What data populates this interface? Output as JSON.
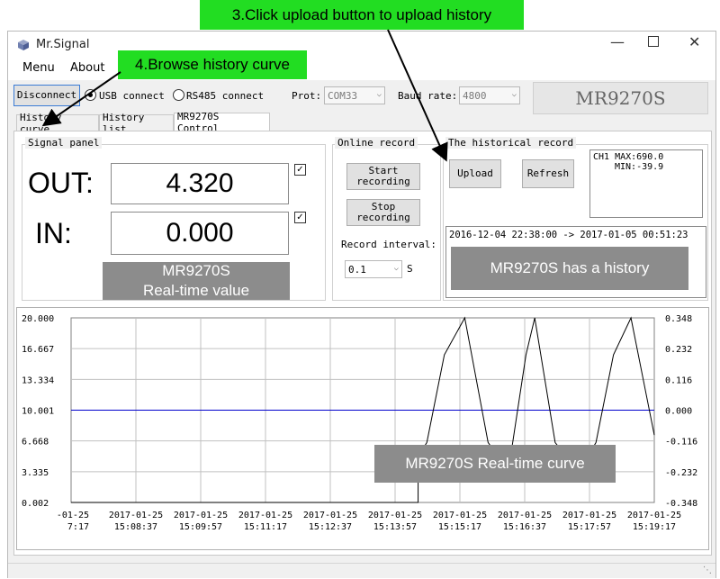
{
  "window": {
    "title": "Mr.Signal"
  },
  "menu": {
    "items": [
      "Menu",
      "About"
    ]
  },
  "toolbar": {
    "disconnect_label": "Disconnect",
    "usb_label": "USB connect",
    "rs485_label": "RS485 connect",
    "port_label": "Prot:",
    "port_value": "COM33",
    "baud_label": "Baud rate:",
    "baud_value": "4800",
    "device_name": "MR9270S"
  },
  "tabs": [
    "History curve",
    "History list",
    "MR9270S Control"
  ],
  "signal_panel": {
    "title": "Signal panel",
    "out_label": "OUT:",
    "out_value": "4.320",
    "in_label": "IN:",
    "in_value": "0.000",
    "caption_line1": "MR9270S",
    "caption_line2": "Real-time value"
  },
  "online_record": {
    "title": "Online record",
    "start_line1": "Start",
    "start_line2": "recording",
    "stop_line1": "Stop",
    "stop_line2": "recording",
    "interval_label": "Record interval:",
    "interval_value": "0.1",
    "interval_unit": "S"
  },
  "historical_record": {
    "title": "The historical record",
    "upload_label": "Upload",
    "refresh_label": "Refresh",
    "stats_line1": "CH1 MAX:690.0",
    "stats_line2": "MIN:-39.9",
    "range_text": "2016-12-04 22:38:00 -> 2017-01-05 00:51:23",
    "caption": "MR9270S has a history"
  },
  "annotations": {
    "step3": "3.Click upload button to upload history",
    "step4": "4.Browse history curve",
    "curve_caption": "MR9270S Real-time curve"
  },
  "chart_data": {
    "type": "line",
    "y_left_ticks": [
      "20.000",
      "16.667",
      "13.334",
      "10.001",
      "6.668",
      "3.335",
      "0.002"
    ],
    "y_right_ticks": [
      "0.348",
      "0.232",
      "0.116",
      "0.000",
      "-0.116",
      "-0.232",
      "-0.348"
    ],
    "x_ticks": [
      [
        "-01-25",
        "7:17"
      ],
      [
        "2017-01-25",
        "15:08:37"
      ],
      [
        "2017-01-25",
        "15:09:57"
      ],
      [
        "2017-01-25",
        "15:11:17"
      ],
      [
        "2017-01-25",
        "15:12:37"
      ],
      [
        "2017-01-25",
        "15:13:57"
      ],
      [
        "2017-01-25",
        "15:15:17"
      ],
      [
        "2017-01-25",
        "15:16:37"
      ],
      [
        "2017-01-25",
        "15:17:57"
      ],
      [
        "2017-01-25",
        "15:19:17"
      ]
    ],
    "ylim_left": [
      0.002,
      20.0
    ],
    "series": [
      {
        "color": "#0000cc",
        "x": [
          0,
          1
        ],
        "y": [
          10.001,
          10.001
        ]
      },
      {
        "color": "#000000",
        "x": [
          0,
          0.595,
          0.595,
          0.61,
          0.64,
          0.675,
          0.715,
          0.75,
          0.78,
          0.795,
          0.83,
          0.87,
          0.9,
          0.93,
          0.96,
          1.0
        ],
        "y": [
          0.002,
          0.002,
          5.0,
          6.5,
          16.0,
          20.0,
          6.5,
          3.5,
          16.0,
          20.0,
          6.5,
          3.3,
          6.5,
          16.0,
          20.0,
          7.3
        ]
      }
    ],
    "colors": {
      "primary": "#0000cc",
      "secondary": "#000000",
      "grid": "#c0c0c0"
    }
  }
}
